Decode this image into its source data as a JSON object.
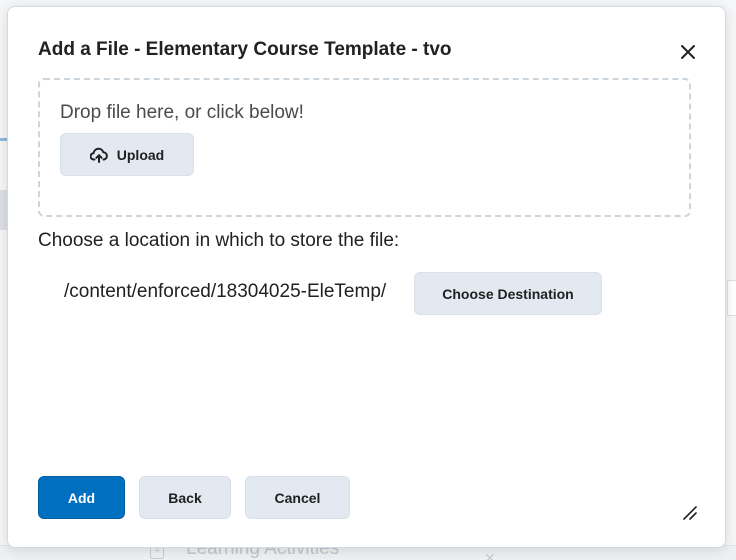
{
  "dialog": {
    "title": "Add a File - Elementary Course Template - tvo",
    "close_icon": "close-icon",
    "drop_zone": {
      "text": "Drop file here, or click below!",
      "upload_label": "Upload",
      "upload_icon": "cloud-upload-icon"
    },
    "location_label": "Choose a location in which to store the file:",
    "path": "/content/enforced/18304025-EleTemp/",
    "choose_destination_label": "Choose Destination",
    "footer": {
      "add_label": "Add",
      "back_label": "Back",
      "cancel_label": "Cancel"
    },
    "resize_icon": "resize-handle-icon"
  },
  "background": {
    "bottom_row_text": "Learning Activities"
  },
  "colors": {
    "primary": "#006fbf",
    "secondary_button": "#e3e9f1",
    "drop_zone_border": "#cdd5dc",
    "text": "#202122"
  }
}
